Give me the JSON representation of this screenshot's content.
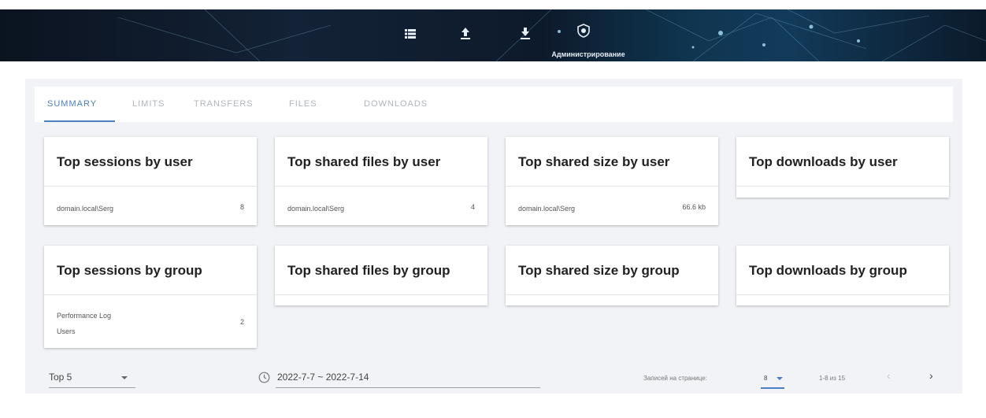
{
  "header": {
    "nav_label": "Администрирование",
    "icons": [
      "list-icon",
      "upload-icon",
      "download-icon",
      "shield-icon"
    ]
  },
  "tabs": [
    {
      "label": "SUMMARY",
      "active": true
    },
    {
      "label": "LIMITS",
      "active": false
    },
    {
      "label": "TRANSFERS",
      "active": false
    },
    {
      "label": "FILES",
      "active": false
    },
    {
      "label": "DOWNLOADS",
      "active": false
    }
  ],
  "cards": {
    "sessions_user": {
      "title": "Top sessions by user",
      "row_label": "domain.local\\Serg",
      "row_value": "8"
    },
    "files_user": {
      "title": "Top shared files by user",
      "row_label": "domain.local\\Serg",
      "row_value": "4"
    },
    "size_user": {
      "title": "Top shared size by user",
      "row_label": "domain.local\\Serg",
      "row_value": "66.6 kb"
    },
    "downloads_user": {
      "title": "Top downloads by user"
    },
    "sessions_group": {
      "title": "Top sessions by group",
      "row_label_1": "Performance Log",
      "row_label_2": "Users",
      "row_value": "2"
    },
    "files_group": {
      "title": "Top shared files by group"
    },
    "size_group": {
      "title": "Top shared size by group"
    },
    "downloads_group": {
      "title": "Top downloads by group"
    }
  },
  "footer": {
    "top_select": "Top 5",
    "date_range": "2022-7-7 ~ 2022-7-14",
    "rows_per_page_label": "Записей на странице:",
    "rows_per_page_value": "8",
    "page_range": "1-8 из 15",
    "prev": "‹",
    "next": "›"
  },
  "colors": {
    "accent": "#4a7fc1",
    "panel_bg": "#f1f3f6"
  }
}
